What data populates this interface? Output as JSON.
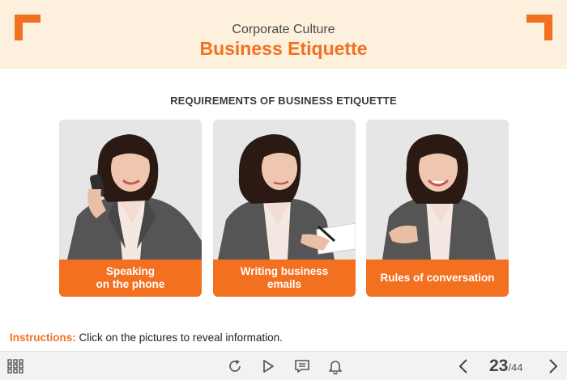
{
  "header": {
    "subtitle": "Corporate Culture",
    "title": "Business Etiquette"
  },
  "section_heading": "REQUIREMENTS OF BUSINESS ETIQUETTE",
  "cards": [
    {
      "line1": "Speaking",
      "line2": "on the phone"
    },
    {
      "line1": "Writing business",
      "line2": "emails"
    },
    {
      "line1": "Rules of conversation",
      "line2": ""
    }
  ],
  "instructions": {
    "label": "Instructions:",
    "text": " Click on the pictures to reveal information."
  },
  "footer": {
    "icons": [
      "grid-menu-icon",
      "replay-icon",
      "play-icon",
      "comment-icon",
      "bell-icon",
      "chevron-left-icon",
      "chevron-right-icon"
    ],
    "current_page": "23",
    "total_pages": "/44"
  },
  "colors": {
    "accent": "#f37021",
    "header_bg": "#fdf0dc",
    "footer_bg": "#f2f2f2"
  }
}
